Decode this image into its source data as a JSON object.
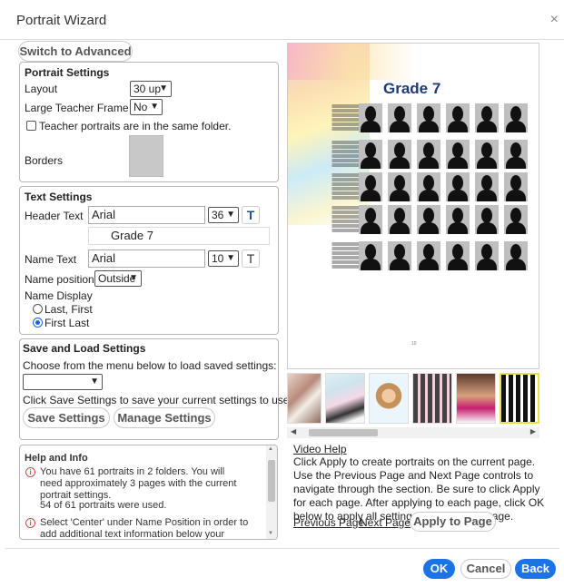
{
  "window": {
    "title": "Portrait Wizard",
    "close": "×"
  },
  "switch_label": "Switch to Advanced",
  "portrait_settings": {
    "title": "Portrait Settings",
    "layout_label": "Layout",
    "layout_value": "30 up",
    "teacher_frame_label": "Large Teacher Frame",
    "teacher_frame_value": "No",
    "same_folder_label": "Teacher portraits are in the same folder.",
    "borders_label": "Borders"
  },
  "text_settings": {
    "title": "Text Settings",
    "header_label": "Header Text",
    "header_font": "Arial",
    "header_size": "36",
    "header_text": "Grade 7",
    "name_label": "Name Text",
    "name_font": "Arial",
    "name_size": "10",
    "t_glyph": "T",
    "position_label": "Name position",
    "position_value": "Outside",
    "display_label": "Name Display",
    "option_last_first": "Last, First",
    "option_first_last": "First Last"
  },
  "save_load": {
    "title": "Save and Load Settings",
    "choose_text": "Choose from the menu below to load saved settings:",
    "save_text": "Click Save Settings to save your current settings to use later.",
    "save_button": "Save Settings",
    "manage_button": "Manage Settings"
  },
  "help": {
    "title": "Help and Info",
    "item1": "You have 61 portraits in 2 folders. You will need approximately 3 pages with the current portrait settings.",
    "used": "54 of 61 portraits were used.",
    "item2": "Select 'Center' under Name Position in order to add additional text information below your portraits."
  },
  "preview": {
    "grade_title": "Grade 7",
    "page_number": "10"
  },
  "right_panel": {
    "video_help": "Video Help",
    "instructions": "Click Apply to create portraits on the current page. Use the Previous Page and Next Page controls to navigate through the section. Be sure to click Apply for each page. After applying to each page, click OK below to apply all settings to the editing page.",
    "previous_page": "Previous Page",
    "next_page": "Next Page",
    "apply_button": "Apply to Page"
  },
  "footer": {
    "ok": "OK",
    "cancel": "Cancel",
    "back": "Back"
  },
  "colors": {
    "accent": "#1a73e8",
    "grade_title": "#1e3b74",
    "info": "#d24a4a"
  },
  "icons": [
    "close-icon",
    "chevron-down-icon",
    "text-color-icon",
    "info-icon",
    "scroll-left-icon",
    "scroll-right-icon"
  ]
}
